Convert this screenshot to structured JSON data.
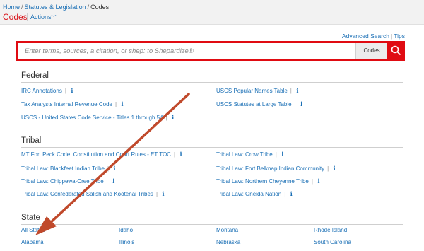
{
  "header": {
    "breadcrumb": {
      "home": "Home",
      "statutes": "Statutes & Legislation",
      "current": "Codes"
    },
    "title": "Codes",
    "actions_label": "Actions"
  },
  "toplinks": {
    "advanced": "Advanced Search",
    "tips": "Tips"
  },
  "search": {
    "placeholder": "Enter terms, sources, a citation, or shep: to Shepardize®",
    "scope": "Codes"
  },
  "federal": {
    "heading": "Federal",
    "items": [
      "IRC Annotations",
      "Tax Analysts Internal Revenue Code",
      "USCS - United States Code Service - Titles 1 through 54",
      "USCS Popular Names Table",
      "USCS Statutes at Large Table"
    ]
  },
  "tribal": {
    "heading": "Tribal",
    "items": [
      "MT Fort Peck Code, Constitution and Court Rules - ET TOC",
      "Tribal Law: Blackfeet Indian Tribe",
      "Tribal Law: Chippewa-Cree Tribe",
      "Tribal Law: Confederated Salish and Kootenai Tribes",
      "Tribal Law: Crow Tribe",
      "Tribal Law: Fort Belknap Indian Community",
      "Tribal Law: Northern Cheyenne Tribe",
      "Tribal Law: Oneida Nation"
    ]
  },
  "state": {
    "heading": "State",
    "items": [
      "All States",
      "Alabama",
      "Idaho",
      "Illinois",
      "Montana",
      "Nebraska",
      "Rhode Island",
      "South Carolina"
    ]
  },
  "icons": {
    "info": "i",
    "accent": "#e00b12",
    "link": "#1a6fb5"
  }
}
